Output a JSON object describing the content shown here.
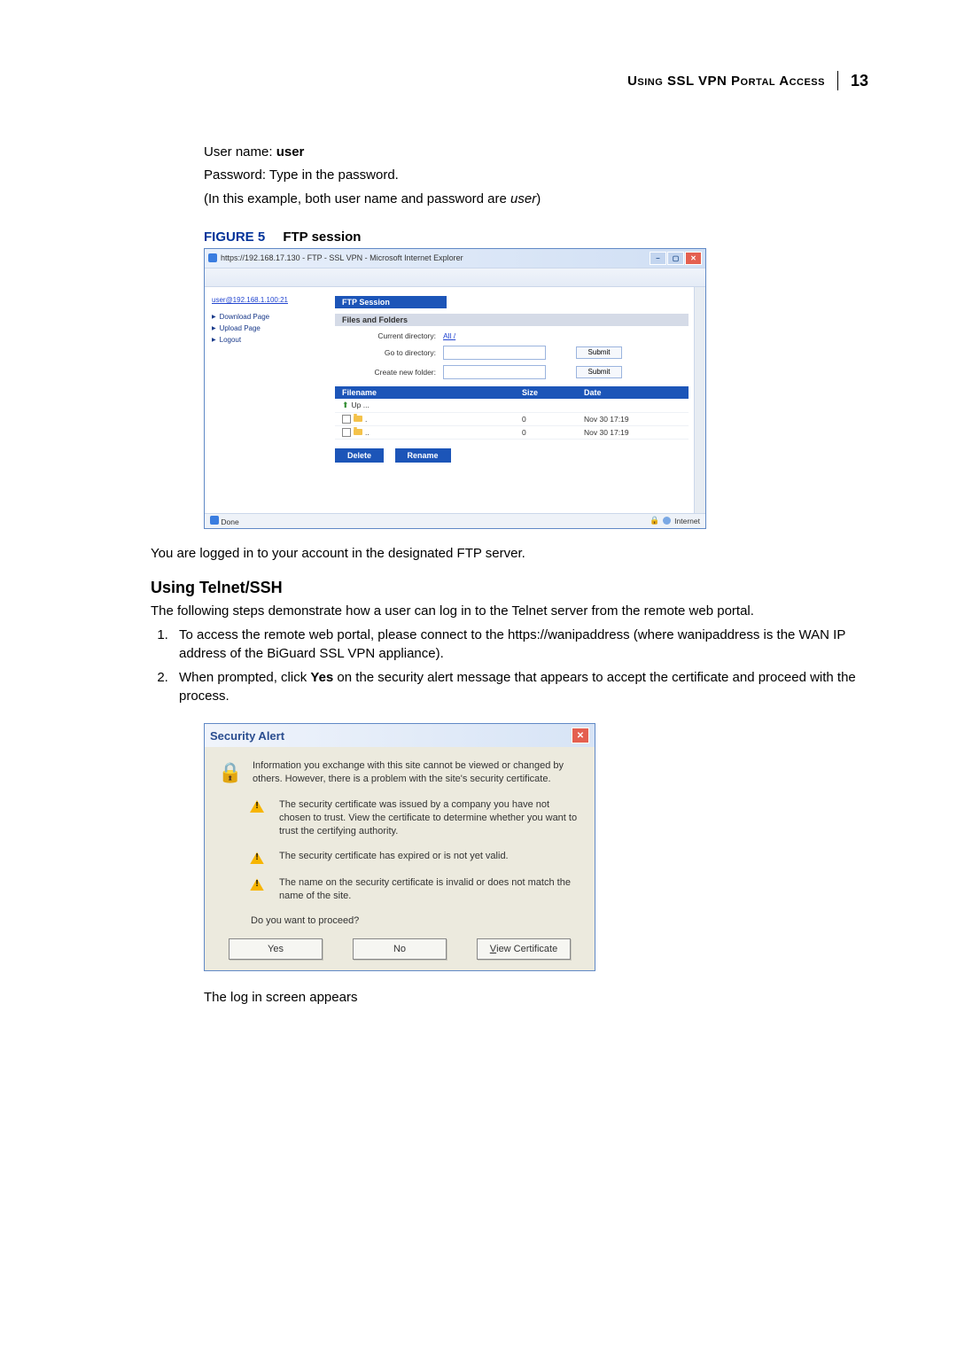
{
  "header": {
    "title": "Using SSL VPN Portal Access",
    "page_number": "13"
  },
  "intro": {
    "line1_prefix": "User name: ",
    "line1_bold": "user",
    "line2": "Password: Type in the password.",
    "line3_prefix": "(In this example, both user name and password are ",
    "line3_italic": "user",
    "line3_suffix": ")"
  },
  "figure5": {
    "label": "FIGURE 5",
    "caption": "FTP session"
  },
  "ftp": {
    "window_title": "https://192.168.17.130 - FTP - SSL VPN - Microsoft Internet Explorer",
    "user_link": "user@192.168.1.100:21",
    "sidebar": {
      "download": "Download Page",
      "upload": "Upload Page",
      "logout": "Logout"
    },
    "session_heading": "FTP Session",
    "files_folders_heading": "Files and Folders",
    "current_dir_label": "Current directory:",
    "current_dir_value": "All /",
    "goto_label": "Go to directory:",
    "create_folder_label": "Create new folder:",
    "submit_label": "Submit",
    "table_headers": {
      "filename": "Filename",
      "size": "Size",
      "date": "Date"
    },
    "rows": {
      "up": {
        "label": "Up ..."
      },
      "r1": {
        "name": ".",
        "size": "0",
        "date": "Nov 30 17:19"
      },
      "r2": {
        "name": "..",
        "size": "0",
        "date": "Nov 30 17:19"
      }
    },
    "buttons": {
      "delete": "Delete",
      "rename": "Rename"
    },
    "status": {
      "done": "Done",
      "zone": "Internet"
    }
  },
  "after_fig_text": "You are logged in to your account in the designated FTP server.",
  "telnet": {
    "heading": "Using Telnet/SSH",
    "intro": "The following steps demonstrate how a user can log in to the Telnet server from the remote web portal.",
    "step1": "To access the remote web portal, please connect to the https://wanipaddress (where wanipaddress is the WAN IP address of the BiGuard SSL VPN appliance).",
    "step2_prefix": "When prompted, click ",
    "step2_bold": "Yes",
    "step2_suffix": " on the security alert message that appears to accept the certificate and proceed with the process."
  },
  "alert": {
    "title": "Security Alert",
    "intro": "Information you exchange with this site cannot be viewed or changed by others. However, there is a problem with the site's security certificate.",
    "item1": "The security certificate was issued by a company you have not chosen to trust. View the certificate to determine whether you want to trust the certifying authority.",
    "item2": "The security certificate has expired or is not yet valid.",
    "item3": "The name on the security certificate is invalid or does not match the name of the site.",
    "question": "Do you want to proceed?",
    "buttons": {
      "yes": "Yes",
      "no": "No",
      "view": "View Certificate"
    }
  },
  "after_alert_text": "The log in screen appears"
}
